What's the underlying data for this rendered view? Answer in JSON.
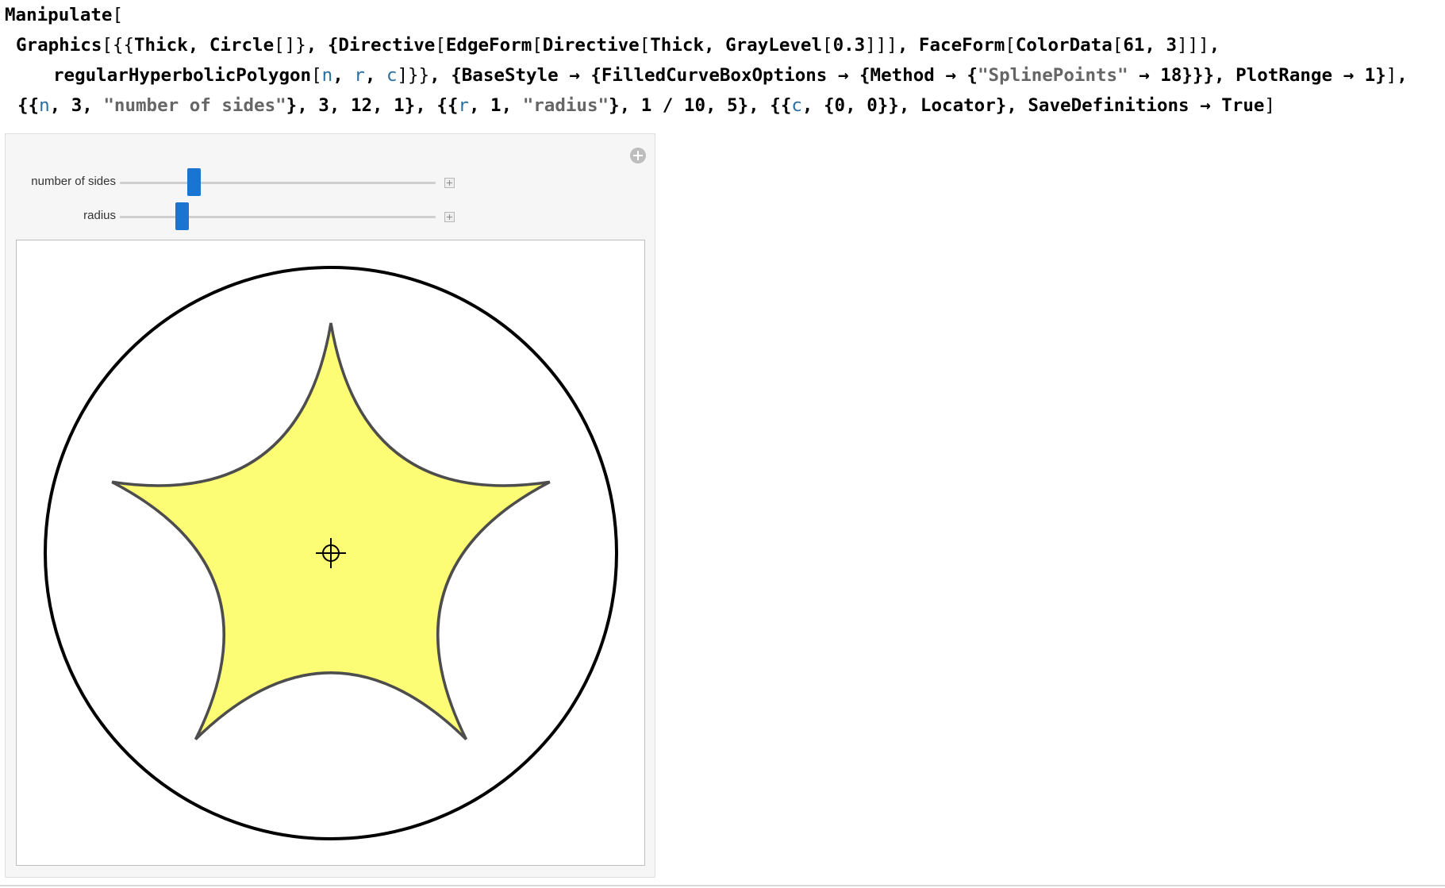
{
  "code": {
    "line1": [
      {
        "t": "Manipulate",
        "k": "tok"
      },
      {
        "t": "[",
        "k": "br"
      }
    ],
    "line2": [
      {
        "t": "Graphics",
        "k": "tok"
      },
      {
        "t": "[{{",
        "k": "br"
      },
      {
        "t": "Thick, Circle",
        "k": "tok"
      },
      {
        "t": "[]}",
        "k": "br"
      },
      {
        "t": ", {",
        "k": "tok"
      },
      {
        "t": "Directive",
        "k": "tok"
      },
      {
        "t": "[",
        "k": "br"
      },
      {
        "t": "EdgeForm",
        "k": "tok"
      },
      {
        "t": "[",
        "k": "br"
      },
      {
        "t": "Directive",
        "k": "tok"
      },
      {
        "t": "[",
        "k": "br"
      },
      {
        "t": "Thick, GrayLevel",
        "k": "tok"
      },
      {
        "t": "[",
        "k": "br"
      },
      {
        "t": "0.3",
        "k": "tok"
      },
      {
        "t": "]]]",
        "k": "br"
      },
      {
        "t": ", FaceForm",
        "k": "tok"
      },
      {
        "t": "[",
        "k": "br"
      },
      {
        "t": "ColorData",
        "k": "tok"
      },
      {
        "t": "[",
        "k": "br"
      },
      {
        "t": "61, 3",
        "k": "tok"
      },
      {
        "t": "]]]",
        "k": "br"
      },
      {
        "t": ",",
        "k": "tok"
      }
    ],
    "line3": [
      {
        "t": "regularHyperbolicPolygon",
        "k": "tok"
      },
      {
        "t": "[",
        "k": "br"
      },
      {
        "t": "n",
        "k": "var"
      },
      {
        "t": ", ",
        "k": "tok"
      },
      {
        "t": "r",
        "k": "var"
      },
      {
        "t": ", ",
        "k": "tok"
      },
      {
        "t": "c",
        "k": "var"
      },
      {
        "t": "]}}",
        "k": "br"
      },
      {
        "t": ", {BaseStyle → {FilledCurveBoxOptions → {Method → {",
        "k": "tok"
      },
      {
        "t": "\"SplinePoints\"",
        "k": "str"
      },
      {
        "t": " → 18}}}, PlotRange → 1}",
        "k": "tok"
      },
      {
        "t": "]",
        "k": "br"
      },
      {
        "t": ",",
        "k": "tok"
      }
    ],
    "line4": [
      {
        "t": "{{",
        "k": "tok"
      },
      {
        "t": "n",
        "k": "var"
      },
      {
        "t": ", 3, ",
        "k": "tok"
      },
      {
        "t": "\"number of sides\"",
        "k": "str"
      },
      {
        "t": "}, 3, 12, 1}, {{",
        "k": "tok"
      },
      {
        "t": "r",
        "k": "var"
      },
      {
        "t": ", 1, ",
        "k": "tok"
      },
      {
        "t": "\"radius\"",
        "k": "str"
      },
      {
        "t": "}, 1 / 10, 5}, {{",
        "k": "tok"
      },
      {
        "t": "c",
        "k": "var"
      },
      {
        "t": ", {0, 0}}, Locator}, SaveDefinitions → True",
        "k": "tok"
      },
      {
        "t": "]",
        "k": "br"
      }
    ]
  },
  "controls": {
    "sides": {
      "label": "number of sides",
      "value": 5,
      "min": 3,
      "max": 12
    },
    "radius": {
      "label": "radius",
      "value": 1,
      "min": 0.1,
      "max": 5
    }
  },
  "graphic": {
    "fill_color": "#fcfc75",
    "edge_color": "#4d4d4d",
    "circle_color": "#000000",
    "locator": "crosshair-locator-icon"
  }
}
